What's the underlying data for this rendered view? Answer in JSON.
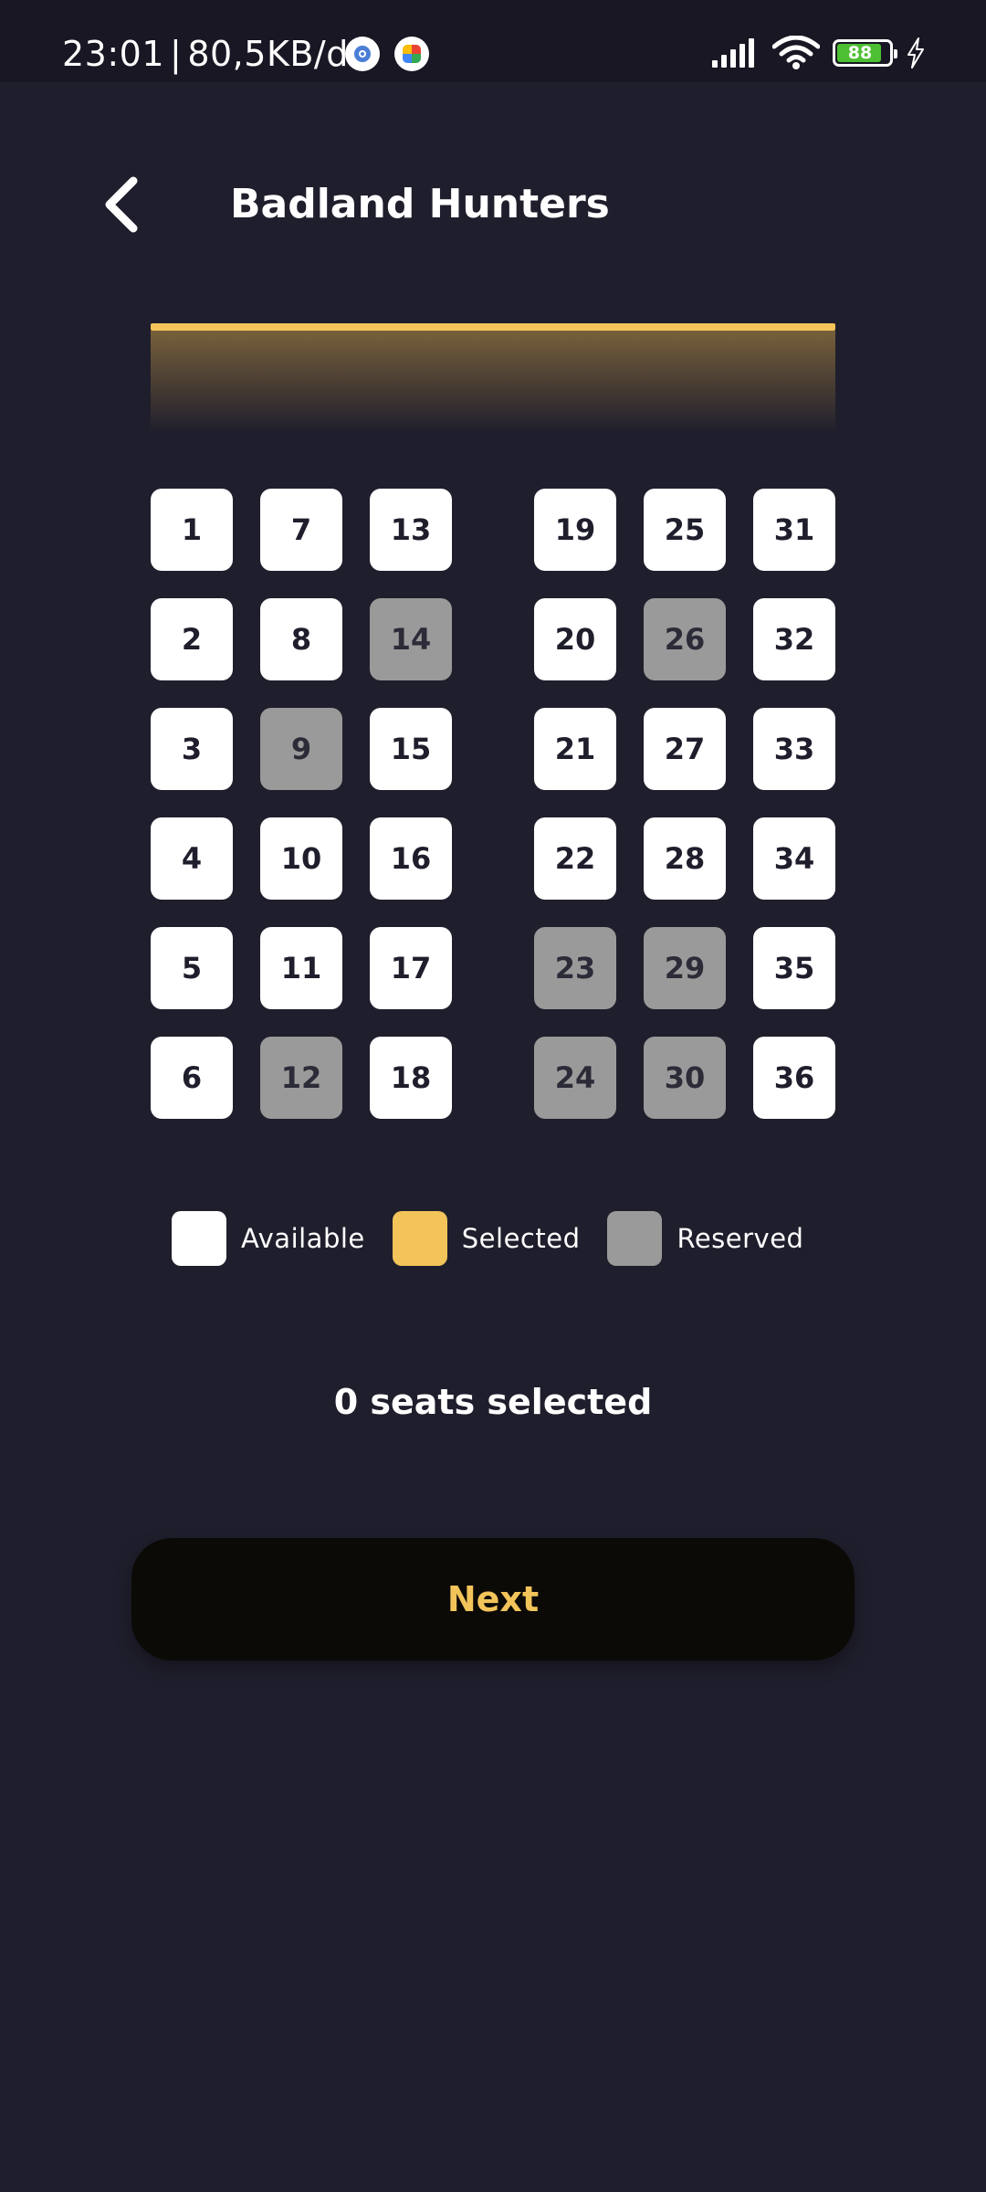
{
  "status_bar": {
    "time": "23:01",
    "separator": "|",
    "network_speed": "80,5KB/d",
    "battery_level": "88",
    "battery_color": "#4cbf33"
  },
  "header": {
    "title": "Badland Hunters",
    "back_icon": "chevron-left-icon"
  },
  "colors": {
    "background": "#1f1e2c",
    "accent": "#f2c45a",
    "available": "#ffffff",
    "selected": "#f2c45a",
    "reserved": "#9a9a9a",
    "button_bg": "#0c0a06"
  },
  "seats": {
    "left_block": [
      {
        "number": "1",
        "status": "available"
      },
      {
        "number": "2",
        "status": "available"
      },
      {
        "number": "3",
        "status": "available"
      },
      {
        "number": "4",
        "status": "available"
      },
      {
        "number": "5",
        "status": "available"
      },
      {
        "number": "6",
        "status": "available"
      },
      {
        "number": "7",
        "status": "available"
      },
      {
        "number": "8",
        "status": "available"
      },
      {
        "number": "9",
        "status": "reserved"
      },
      {
        "number": "10",
        "status": "available"
      },
      {
        "number": "11",
        "status": "available"
      },
      {
        "number": "12",
        "status": "reserved"
      },
      {
        "number": "13",
        "status": "available"
      },
      {
        "number": "14",
        "status": "reserved"
      },
      {
        "number": "15",
        "status": "available"
      },
      {
        "number": "16",
        "status": "available"
      },
      {
        "number": "17",
        "status": "available"
      },
      {
        "number": "18",
        "status": "available"
      }
    ],
    "right_block": [
      {
        "number": "19",
        "status": "available"
      },
      {
        "number": "20",
        "status": "available"
      },
      {
        "number": "21",
        "status": "available"
      },
      {
        "number": "22",
        "status": "available"
      },
      {
        "number": "23",
        "status": "reserved"
      },
      {
        "number": "24",
        "status": "reserved"
      },
      {
        "number": "25",
        "status": "available"
      },
      {
        "number": "26",
        "status": "reserved"
      },
      {
        "number": "27",
        "status": "available"
      },
      {
        "number": "28",
        "status": "available"
      },
      {
        "number": "29",
        "status": "reserved"
      },
      {
        "number": "30",
        "status": "reserved"
      },
      {
        "number": "31",
        "status": "available"
      },
      {
        "number": "32",
        "status": "available"
      },
      {
        "number": "33",
        "status": "available"
      },
      {
        "number": "34",
        "status": "available"
      },
      {
        "number": "35",
        "status": "available"
      },
      {
        "number": "36",
        "status": "available"
      }
    ]
  },
  "legend": {
    "available": "Available",
    "selected": "Selected",
    "reserved": "Reserved"
  },
  "summary": {
    "seats_selected_text": "0 seats selected"
  },
  "actions": {
    "next_label": "Next"
  }
}
